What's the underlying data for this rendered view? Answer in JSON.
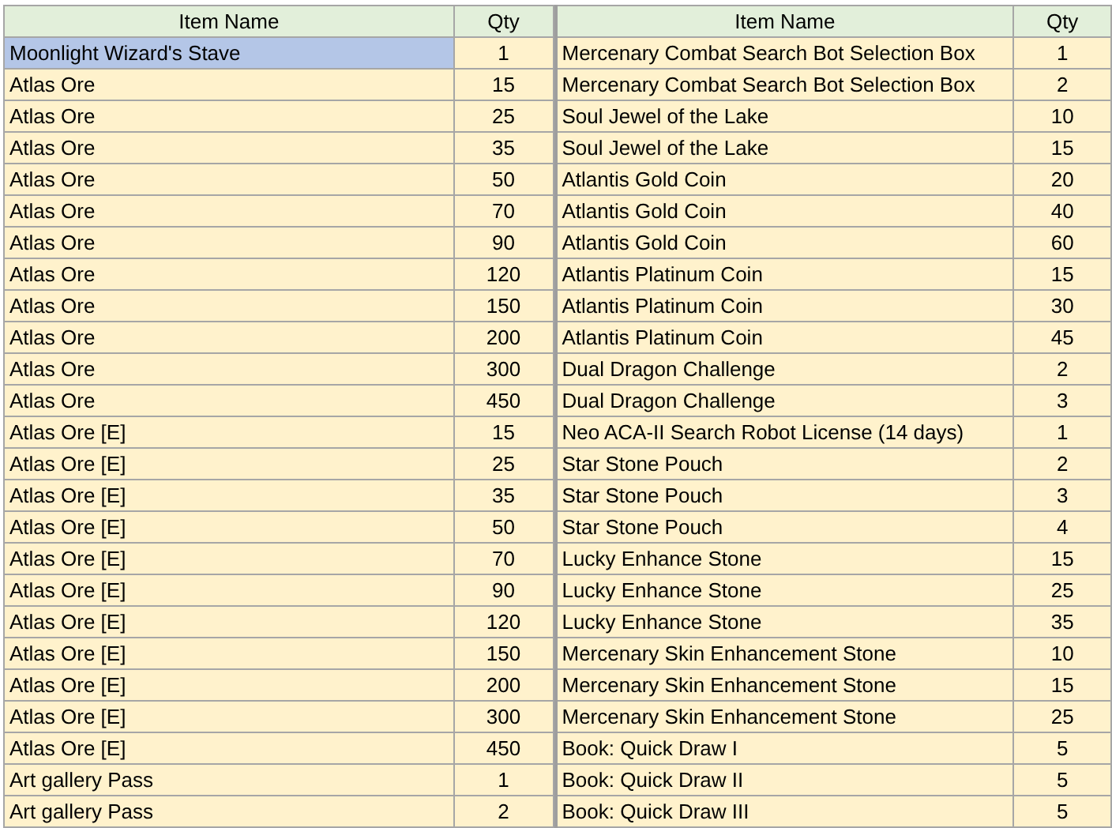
{
  "tables": [
    {
      "columns": [
        "Item Name",
        "Qty"
      ],
      "rows": [
        {
          "item": "Moonlight Wizard's Stave",
          "qty": "1",
          "selected": true
        },
        {
          "item": "Atlas Ore",
          "qty": "15",
          "selected": false
        },
        {
          "item": "Atlas Ore",
          "qty": "25",
          "selected": false
        },
        {
          "item": "Atlas Ore",
          "qty": "35",
          "selected": false
        },
        {
          "item": "Atlas Ore",
          "qty": "50",
          "selected": false
        },
        {
          "item": "Atlas Ore",
          "qty": "70",
          "selected": false
        },
        {
          "item": "Atlas Ore",
          "qty": "90",
          "selected": false
        },
        {
          "item": "Atlas Ore",
          "qty": "120",
          "selected": false
        },
        {
          "item": "Atlas Ore",
          "qty": "150",
          "selected": false
        },
        {
          "item": "Atlas Ore",
          "qty": "200",
          "selected": false
        },
        {
          "item": "Atlas Ore",
          "qty": "300",
          "selected": false
        },
        {
          "item": "Atlas Ore",
          "qty": "450",
          "selected": false
        },
        {
          "item": "Atlas Ore [E]",
          "qty": "15",
          "selected": false
        },
        {
          "item": "Atlas Ore [E]",
          "qty": "25",
          "selected": false
        },
        {
          "item": "Atlas Ore [E]",
          "qty": "35",
          "selected": false
        },
        {
          "item": "Atlas Ore [E]",
          "qty": "50",
          "selected": false
        },
        {
          "item": "Atlas Ore [E]",
          "qty": "70",
          "selected": false
        },
        {
          "item": "Atlas Ore [E]",
          "qty": "90",
          "selected": false
        },
        {
          "item": "Atlas Ore [E]",
          "qty": "120",
          "selected": false
        },
        {
          "item": "Atlas Ore [E]",
          "qty": "150",
          "selected": false
        },
        {
          "item": "Atlas Ore [E]",
          "qty": "200",
          "selected": false
        },
        {
          "item": "Atlas Ore [E]",
          "qty": "300",
          "selected": false
        },
        {
          "item": "Atlas Ore [E]",
          "qty": "450",
          "selected": false
        },
        {
          "item": "Art gallery Pass",
          "qty": "1",
          "selected": false
        },
        {
          "item": "Art gallery Pass",
          "qty": "2",
          "selected": false
        }
      ]
    },
    {
      "columns": [
        "Item Name",
        "Qty"
      ],
      "rows": [
        {
          "item": "Mercenary Combat Search Bot Selection Box",
          "qty": "1",
          "selected": false
        },
        {
          "item": "Mercenary Combat Search Bot Selection Box",
          "qty": "2",
          "selected": false
        },
        {
          "item": "Soul Jewel of the Lake",
          "qty": "10",
          "selected": false
        },
        {
          "item": "Soul Jewel of the Lake",
          "qty": "15",
          "selected": false
        },
        {
          "item": "Atlantis Gold Coin",
          "qty": "20",
          "selected": false
        },
        {
          "item": "Atlantis Gold Coin",
          "qty": "40",
          "selected": false
        },
        {
          "item": "Atlantis Gold Coin",
          "qty": "60",
          "selected": false
        },
        {
          "item": "Atlantis Platinum Coin",
          "qty": "15",
          "selected": false
        },
        {
          "item": "Atlantis Platinum Coin",
          "qty": "30",
          "selected": false
        },
        {
          "item": "Atlantis Platinum Coin",
          "qty": "45",
          "selected": false
        },
        {
          "item": "Dual Dragon Challenge",
          "qty": "2",
          "selected": false
        },
        {
          "item": "Dual Dragon Challenge",
          "qty": "3",
          "selected": false
        },
        {
          "item": "Neo ACA-II Search Robot License (14 days)",
          "qty": "1",
          "selected": false
        },
        {
          "item": "Star Stone Pouch",
          "qty": "2",
          "selected": false
        },
        {
          "item": "Star Stone Pouch",
          "qty": "3",
          "selected": false
        },
        {
          "item": "Star Stone Pouch",
          "qty": "4",
          "selected": false
        },
        {
          "item": "Lucky Enhance Stone",
          "qty": "15",
          "selected": false
        },
        {
          "item": "Lucky Enhance Stone",
          "qty": "25",
          "selected": false
        },
        {
          "item": "Lucky Enhance Stone",
          "qty": "35",
          "selected": false
        },
        {
          "item": "Mercenary Skin Enhancement Stone",
          "qty": "10",
          "selected": false
        },
        {
          "item": "Mercenary Skin Enhancement Stone",
          "qty": "15",
          "selected": false
        },
        {
          "item": "Mercenary Skin Enhancement Stone",
          "qty": "25",
          "selected": false
        },
        {
          "item": "Book: Quick Draw I",
          "qty": "5",
          "selected": false
        },
        {
          "item": "Book: Quick Draw II",
          "qty": "5",
          "selected": false
        },
        {
          "item": "Book: Quick Draw III",
          "qty": "5",
          "selected": false
        }
      ]
    }
  ]
}
